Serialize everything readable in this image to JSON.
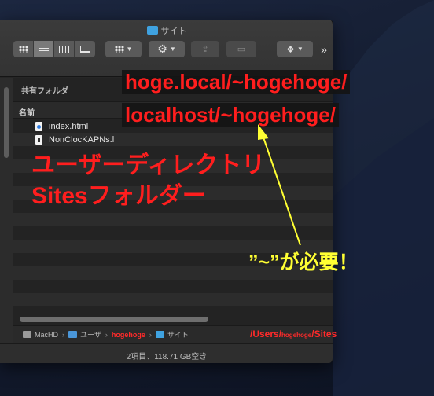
{
  "window": {
    "title": "サイト"
  },
  "toolbar": {
    "more_label": "»"
  },
  "sidebar": {
    "section_label": "共有フォルダ"
  },
  "list": {
    "column_name": "名前",
    "files": [
      {
        "name": "index.html",
        "icon": "html-file-icon"
      },
      {
        "name": "NonClocKAPNs.l",
        "icon": "binary-file-icon"
      }
    ]
  },
  "pathbar": {
    "items": [
      {
        "label": "MacHD",
        "icon": "disk-icon"
      },
      {
        "label": "ユーザ",
        "icon": "home-folder-icon"
      },
      {
        "label": "hogehoge",
        "icon": "none"
      },
      {
        "label": "サイト",
        "icon": "folder-icon"
      }
    ],
    "overlay_path_prefix": "/Users/",
    "overlay_path_user": "hogehoge",
    "overlay_path_suffix": "/Sites"
  },
  "statusbar": {
    "text": "2項目、118.71 GB空き"
  },
  "annotations": {
    "url_line1": "hoge.local/~hogehoge/",
    "url_line2": "localhost/~hogehoge/",
    "label_line1": "ユーザーディレクトリ",
    "label_line2": "Sitesフォルダー",
    "tilde_note": "”~”が必要！",
    "red": "#ff1e1e",
    "yellow": "#ffff33"
  }
}
